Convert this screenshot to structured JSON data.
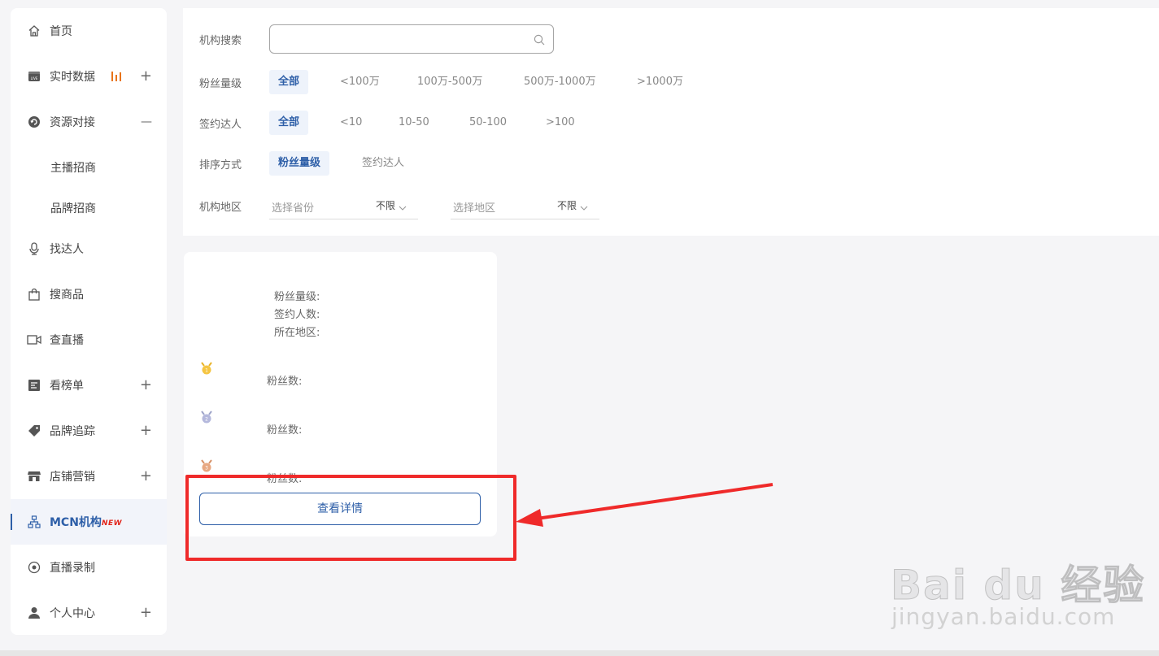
{
  "sidebar": {
    "items": [
      {
        "label": "首页",
        "icon": "home-icon"
      },
      {
        "label": "实时数据",
        "icon": "live-data-icon",
        "right": "+"
      },
      {
        "label": "资源对接",
        "icon": "resource-icon",
        "right": "—"
      },
      {
        "label": "主播招商"
      },
      {
        "label": "品牌招商"
      },
      {
        "label": "找达人",
        "icon": "microphone-icon"
      },
      {
        "label": "搜商品",
        "icon": "shopping-bag-icon"
      },
      {
        "label": "查直播",
        "icon": "video-icon"
      },
      {
        "label": "看榜单",
        "icon": "chart-list-icon",
        "right": "+"
      },
      {
        "label": "品牌追踪",
        "icon": "tag-icon",
        "right": "+"
      },
      {
        "label": "店铺营销",
        "icon": "store-icon",
        "right": "+"
      },
      {
        "label": "MCN机构",
        "icon": "org-icon",
        "badge": "NEW"
      },
      {
        "label": "直播录制",
        "icon": "record-icon"
      },
      {
        "label": "个人中心",
        "icon": "user-icon",
        "right": "+"
      }
    ],
    "accent_color": "#2e5fa8",
    "badge_color": "#e1251b"
  },
  "filters": {
    "search": {
      "label": "机构搜索",
      "value": "",
      "placeholder": ""
    },
    "fans": {
      "label": "粉丝量级",
      "options": [
        "全部",
        "<100万",
        "100万-500万",
        "500万-1000万",
        ">1000万"
      ],
      "selected": "全部"
    },
    "signed": {
      "label": "签约达人",
      "options": [
        "全部",
        "<10",
        "10-50",
        "50-100",
        ">100"
      ],
      "selected": "全部"
    },
    "sort": {
      "label": "排序方式",
      "options": [
        "粉丝量级",
        "签约达人"
      ],
      "selected": "粉丝量级"
    },
    "region": {
      "label": "机构地区",
      "province": {
        "placeholder": "选择省份",
        "value": "不限"
      },
      "area": {
        "placeholder": "选择地区",
        "value": "不限"
      }
    }
  },
  "card": {
    "fans_level_label": "粉丝量级:",
    "signed_count_label": "签约人数:",
    "region_label": "所在地区:",
    "top_talents": [
      {
        "medal": "gold",
        "fans_label": "粉丝数:"
      },
      {
        "medal": "silver",
        "fans_label": "粉丝数:"
      },
      {
        "medal": "bronze",
        "fans_label": "粉丝数:"
      }
    ],
    "detail_button": "查看详情"
  },
  "watermark": {
    "text": "jingyan.baidu.com",
    "logo": "Bai du 经验"
  }
}
